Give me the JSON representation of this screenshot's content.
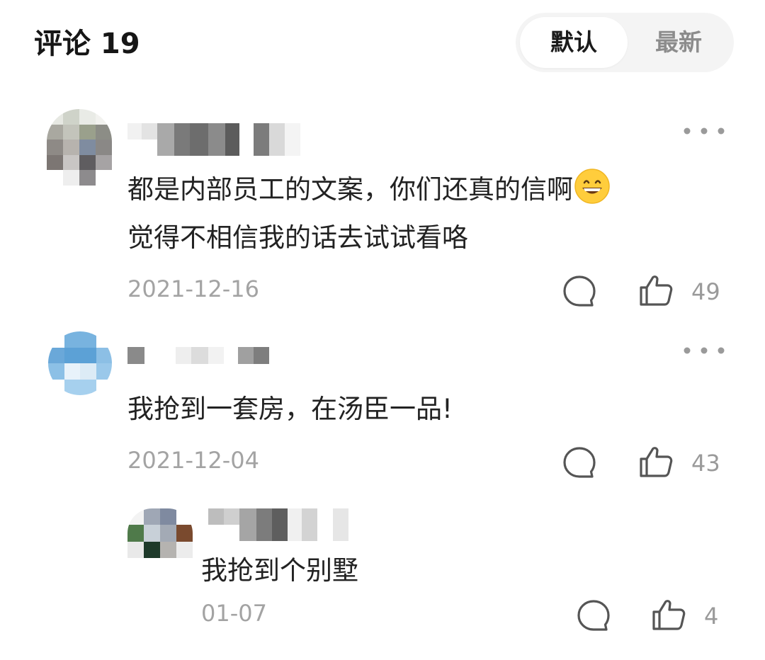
{
  "header": {
    "title": "评论 19",
    "sort_options": [
      "默认",
      "最新"
    ],
    "active_sort": "默认"
  },
  "comments": [
    {
      "text_lines": [
        "都是内部员工的文案，你们还真的信啊",
        "觉得不相信我的话去试试看咯"
      ],
      "emoji": "grinning-face-emoji",
      "date": "2021-12-16",
      "likes": "49"
    },
    {
      "text_lines": [
        "我抢到一套房，在汤臣一品!"
      ],
      "date": "2021-12-04",
      "likes": "43",
      "replies": [
        {
          "text": "我抢到个别墅",
          "date": "01-07",
          "likes": "4"
        }
      ]
    }
  ],
  "icons": {
    "more": "more-dots-icon",
    "reply": "comment-bubble-icon",
    "like": "thumbs-up-icon"
  },
  "colors": {
    "text": "#222222",
    "meta": "#a3a3a3",
    "toggle_bg": "#f4f4f4"
  }
}
